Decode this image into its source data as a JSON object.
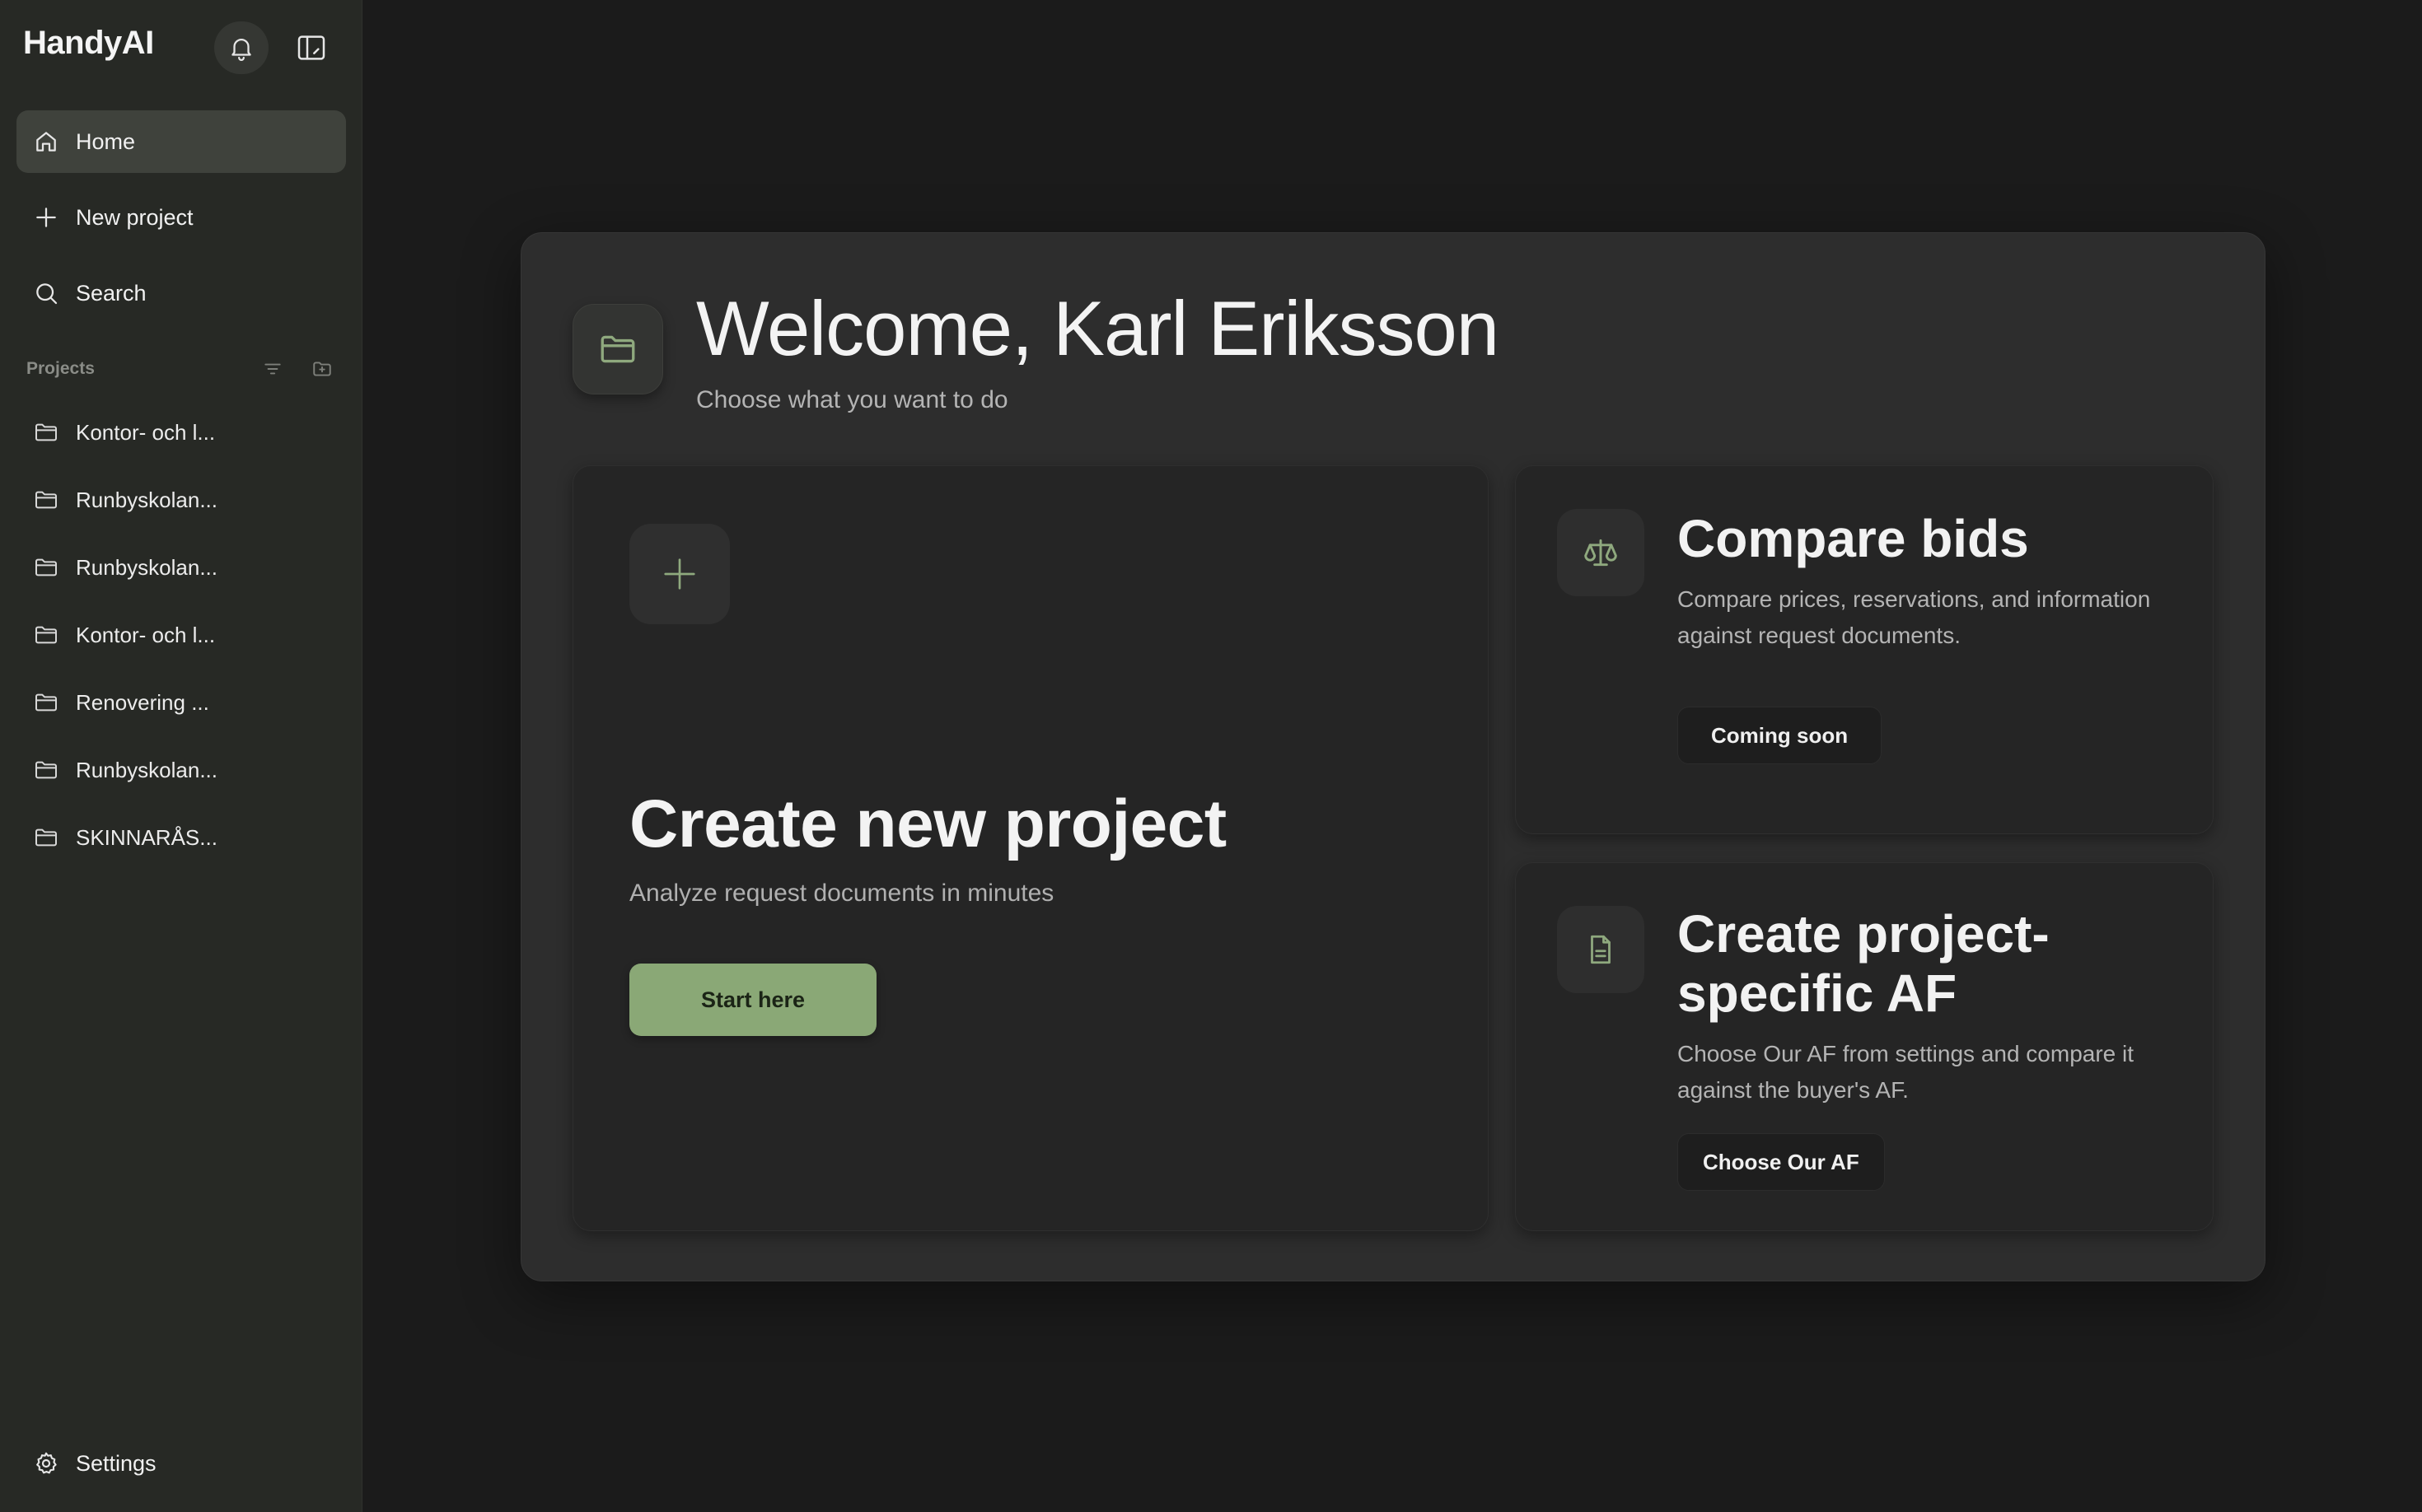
{
  "app": {
    "name": "HandyAI"
  },
  "sidebar": {
    "nav": [
      {
        "label": "Home",
        "icon": "home-icon",
        "active": true
      },
      {
        "label": "New project",
        "icon": "plus-icon"
      },
      {
        "label": "Search",
        "icon": "search-icon"
      }
    ],
    "projects_label": "Projects",
    "projects": [
      "Kontor- och l...",
      "Runbyskolan...",
      "Runbyskolan...",
      "Kontor- och l...",
      "Renovering ...",
      "Runbyskolan...",
      "SKINNARÅS..."
    ],
    "settings_label": "Settings"
  },
  "main": {
    "welcome": "Welcome, Karl Eriksson",
    "subtitle": "Choose what you want to do",
    "create": {
      "title": "Create new project",
      "subtitle": "Analyze request documents in minutes",
      "button": "Start here"
    },
    "compare": {
      "title": "Compare bids",
      "desc": "Compare prices, reservations, and information against request documents.",
      "button": "Coming soon"
    },
    "af": {
      "title": "Create project-specific AF",
      "desc": "Choose Our AF from settings and compare it against the buyer's AF.",
      "button": "Choose Our AF"
    }
  },
  "colors": {
    "accent": "#8aa876",
    "icon_green": "#8fa97e",
    "sidebar_bg": "#272925",
    "page_bg": "#1b1b1b"
  }
}
